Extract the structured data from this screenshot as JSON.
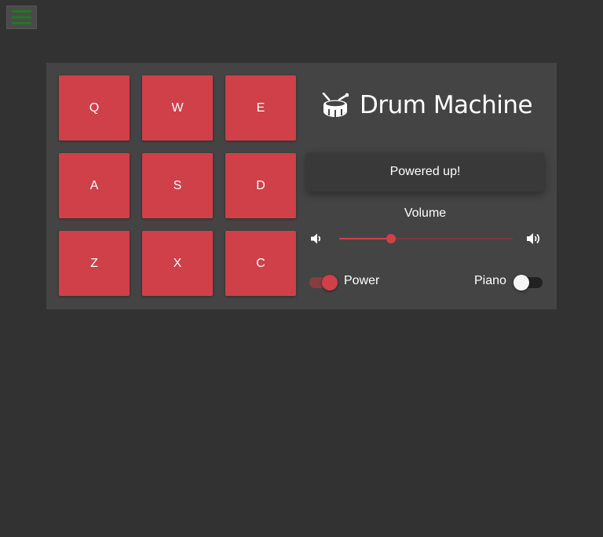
{
  "menu": {
    "icon": "hamburger-menu-icon",
    "icon_color": "#1e7b1e"
  },
  "pads": [
    {
      "key": "Q"
    },
    {
      "key": "W"
    },
    {
      "key": "E"
    },
    {
      "key": "A"
    },
    {
      "key": "S"
    },
    {
      "key": "D"
    },
    {
      "key": "Z"
    },
    {
      "key": "X"
    },
    {
      "key": "C"
    }
  ],
  "header": {
    "title": "Drum Machine",
    "icon": "drum-icon"
  },
  "display": {
    "text": "Powered up!"
  },
  "volume": {
    "label": "Volume",
    "value": 0.3,
    "down_icon": "volume-down-icon",
    "up_icon": "volume-up-icon"
  },
  "power": {
    "label": "Power",
    "on": true
  },
  "piano": {
    "label": "Piano",
    "on": false
  },
  "colors": {
    "background": "#323232",
    "panel": "#444444",
    "accent": "#cf4049",
    "display": "#393939"
  }
}
